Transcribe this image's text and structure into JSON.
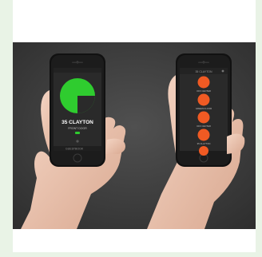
{
  "phone_left": {
    "address": "35 CLAYTON",
    "door": "FRONT DOOR",
    "bottom_bar": "GUESTBOOK",
    "unlock_color": "#2fcc2f"
  },
  "phone_right": {
    "header": "35 CLAYTON",
    "buttons": [
      {
        "label": "OFF CENTER"
      },
      {
        "label": "GREEN FLOOR"
      },
      {
        "label": "OFF CENTER"
      },
      {
        "label": "35 CLAYTON"
      },
      {
        "label": ""
      }
    ],
    "button_color": "#f05a23"
  }
}
